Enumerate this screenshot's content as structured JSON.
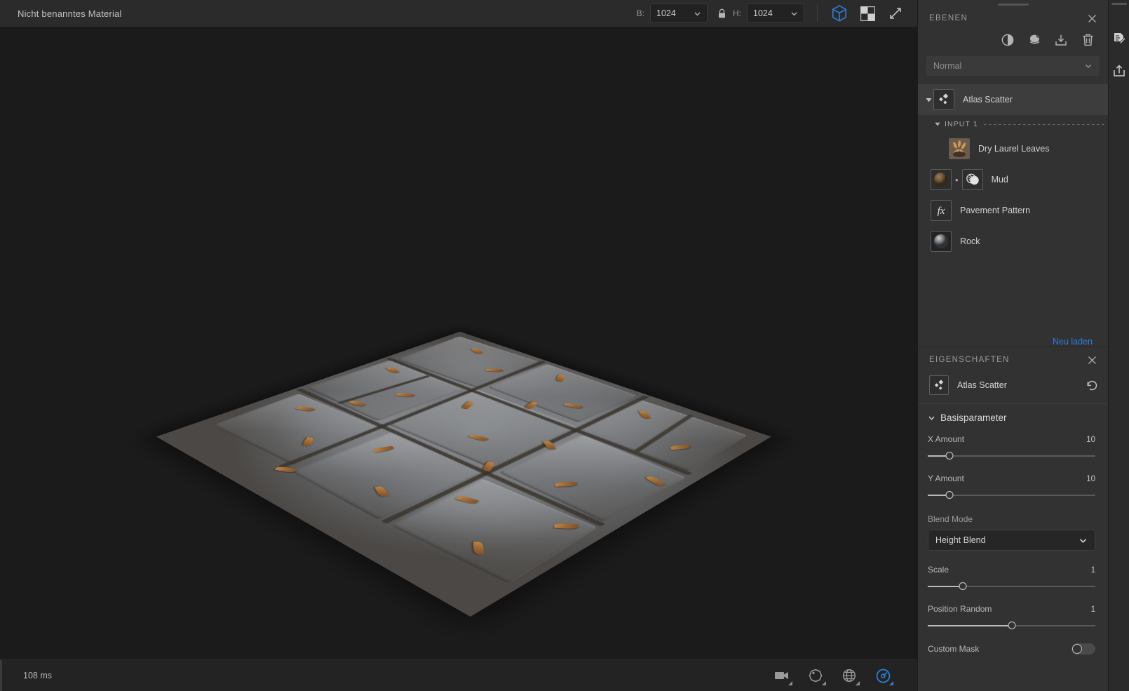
{
  "topbar": {
    "document_title": "Nicht benanntes Material",
    "width_label": "B:",
    "width_value": "1024",
    "height_label": "H:",
    "height_value": "1024",
    "lock_icon": "lock-icon",
    "icons": [
      "cube-3d-icon",
      "checker-2d-icon",
      "expand-icon"
    ]
  },
  "viewport": {
    "material_name": "Pavement with dry laurel leaves"
  },
  "statusbar": {
    "render_time": "108 ms",
    "icons": [
      "camera-icon",
      "material-sphere-icon",
      "environment-globe-icon",
      "render-mode-icon"
    ]
  },
  "layers_panel": {
    "title": "EBENEN",
    "close_icon": "close-icon",
    "tools": [
      {
        "name": "adjustment-circle-icon",
        "label": "Adjustment"
      },
      {
        "name": "effects-icon",
        "label": "Effects"
      },
      {
        "name": "import-icon",
        "label": "Import"
      },
      {
        "name": "trash-icon",
        "label": "Delete"
      }
    ],
    "blend_mode": "Normal",
    "reload_link": "Neu laden",
    "root_layer": {
      "name": "Atlas Scatter",
      "icon": "atlas-scatter-icon",
      "selected": true,
      "expanded": true
    },
    "input_group_label": "INPUT 1",
    "children": [
      {
        "name": "Dry Laurel Leaves",
        "thumb": "leaves-thumbnail",
        "has_mask": false,
        "icon_type": "image"
      },
      {
        "name": "Mud",
        "thumb": "mud-sphere-thumbnail",
        "has_mask": true,
        "mask_icon": "mask-icon",
        "icon_type": "material"
      },
      {
        "name": "Pavement Pattern",
        "thumb": "fx-icon",
        "has_mask": false,
        "icon_type": "fx"
      },
      {
        "name": "Rock",
        "thumb": "rock-sphere-thumbnail",
        "has_mask": false,
        "icon_type": "material"
      }
    ]
  },
  "properties_panel": {
    "title": "EIGENSCHAFTEN",
    "close_icon": "close-icon",
    "header_name": "Atlas Scatter",
    "header_icon": "atlas-scatter-icon",
    "revert_icon": "revert-icon",
    "section": {
      "title": "Basisparameter",
      "expanded": true
    },
    "params": [
      {
        "label": "X Amount",
        "value": "10",
        "type": "slider",
        "pct": 13
      },
      {
        "label": "Y Amount",
        "value": "10",
        "type": "slider",
        "pct": 13
      },
      {
        "label": "Blend Mode",
        "value": "Height Blend",
        "type": "dropdown"
      },
      {
        "label": "Scale",
        "value": "1",
        "type": "slider",
        "pct": 21
      },
      {
        "label": "Position Random",
        "value": "1",
        "type": "slider",
        "pct": 50
      },
      {
        "label": "Custom Mask",
        "value": "",
        "type": "toggle",
        "on": false
      }
    ]
  },
  "rail": {
    "icons": [
      "document-edit-icon",
      "export-share-icon"
    ]
  },
  "colors": {
    "accent_blue": "#2b7de0",
    "panel_bg": "#323232",
    "viewport_bg": "#1b1b1b",
    "topbar_bg": "#2b2b2b"
  }
}
